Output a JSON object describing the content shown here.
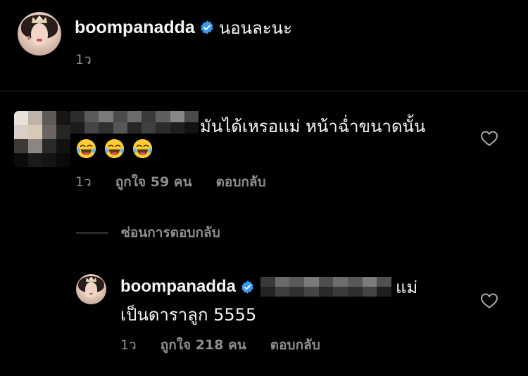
{
  "post": {
    "username": "boompanadda",
    "caption": "นอนละนะ",
    "time": "1ว"
  },
  "comment": {
    "text_line1": "มันได้เหรอแม่ หน้าฉ่ำขนาดนั้น",
    "emojis": [
      "😂",
      "😂",
      "😂"
    ],
    "time": "1ว",
    "likes": "ถูกใจ 59 คน",
    "reply_label": "ตอบกลับ"
  },
  "hide_replies": {
    "label": "ซ่อนการตอบกลับ"
  },
  "reply": {
    "username": "boompanadda",
    "text_after_mention": "แม่",
    "text_line2": "เป็นดาราลูก 5555",
    "time": "1ว",
    "likes": "ถูกใจ 218 คน",
    "reply_label": "ตอบกลับ"
  },
  "colors": {
    "background": "#000000",
    "primary_text": "#f5f5f5",
    "secondary_text": "#8e8e8e",
    "verified_badge": "#3897f0",
    "divider": "#262626"
  },
  "icons": {
    "verified": "verified-badge-icon",
    "like": "heart-outline-icon",
    "emoji": "face-with-tears-of-joy"
  }
}
